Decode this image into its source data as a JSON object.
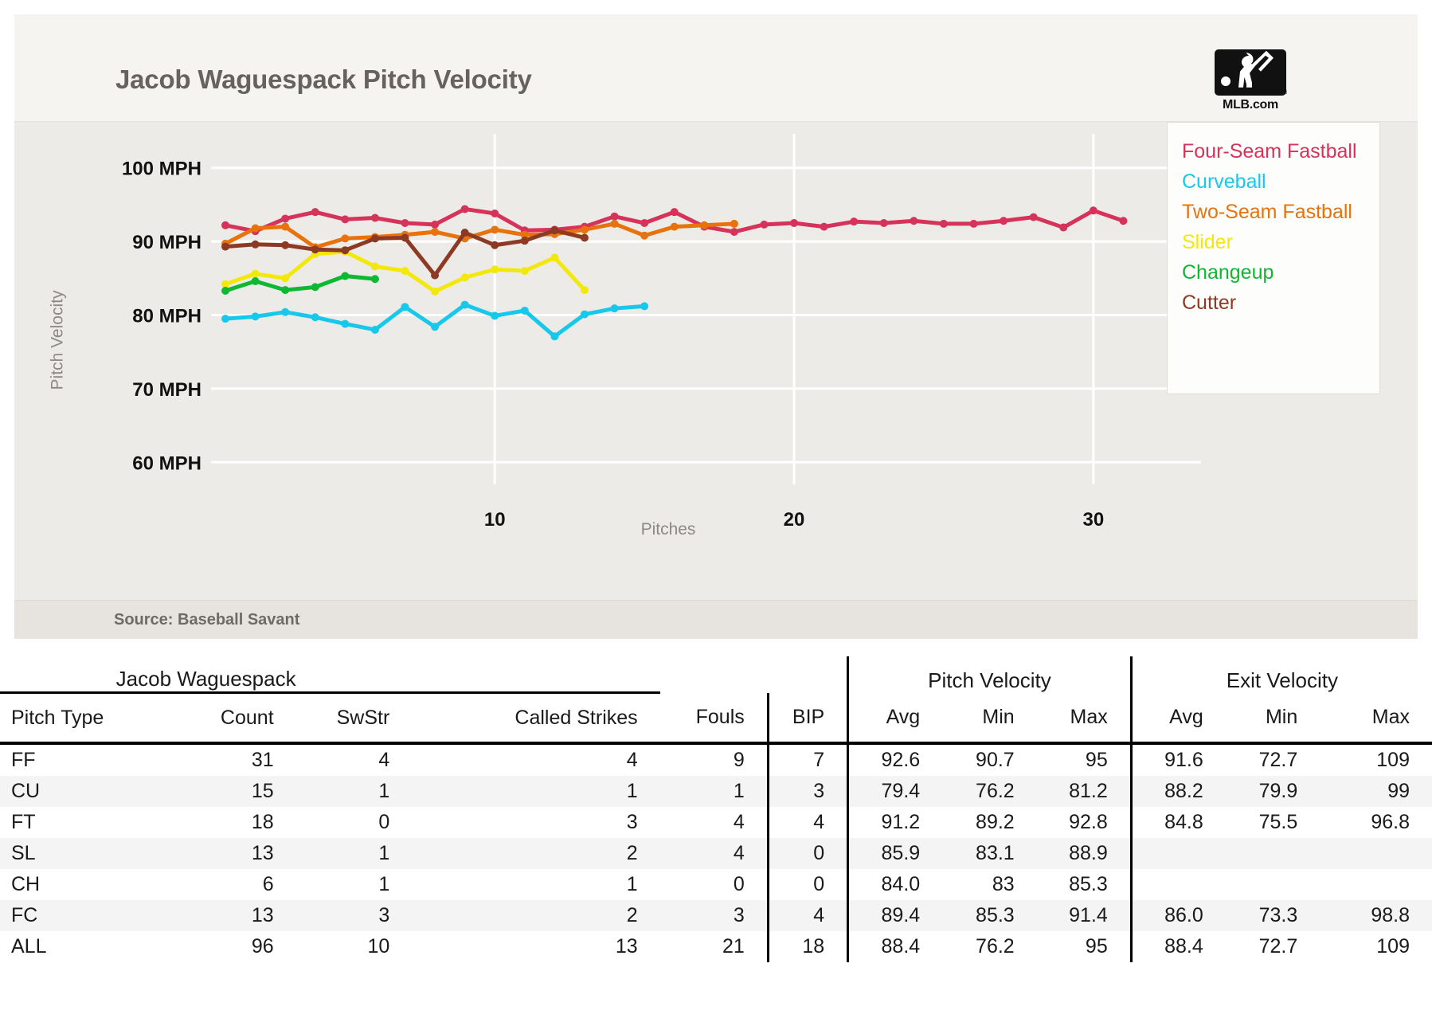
{
  "header": {
    "title": "Jacob Waguespack Pitch Velocity",
    "logo_name": "mlb-logo",
    "logo_text": "MLB.com"
  },
  "source": {
    "text": "Source: Baseball Savant"
  },
  "chart_data": {
    "type": "line",
    "title": "Jacob Waguespack Pitch Velocity",
    "xlabel": "Pitches",
    "ylabel": "Pitch Velocity",
    "xlim": [
      1,
      32
    ],
    "ylim": [
      57,
      103
    ],
    "xticks": [
      10,
      20,
      30
    ],
    "xticklabels": [
      "10",
      "20",
      "30"
    ],
    "yticks": [
      60,
      70,
      80,
      90,
      100
    ],
    "yticklabels": [
      "60 MPH",
      "70 MPH",
      "80 MPH",
      "90 MPH",
      "100 MPH"
    ],
    "grid": true,
    "legend_position": "right",
    "series": [
      {
        "name": "Four-Seam Fastball",
        "color": "#d6335b",
        "x": [
          1,
          2,
          3,
          4,
          5,
          6,
          7,
          8,
          9,
          10,
          11,
          12,
          13,
          14,
          15,
          16,
          17,
          18,
          19,
          20,
          21,
          22,
          23,
          24,
          25,
          26,
          27,
          28,
          29,
          30,
          31
        ],
        "y": [
          92.2,
          91.4,
          93.1,
          94.0,
          93.0,
          93.2,
          92.5,
          92.3,
          94.4,
          93.8,
          91.5,
          91.6,
          92.0,
          93.4,
          92.5,
          94.0,
          92.0,
          91.3,
          92.3,
          92.5,
          92.0,
          92.7,
          92.5,
          92.8,
          92.4,
          92.4,
          92.8,
          93.3,
          91.9,
          94.2,
          92.8
        ]
      },
      {
        "name": "Curveball",
        "color": "#17c8ea",
        "x": [
          1,
          2,
          3,
          4,
          5,
          6,
          7,
          8,
          9,
          10,
          11,
          12,
          13,
          14,
          15
        ],
        "y": [
          79.5,
          79.8,
          80.4,
          79.7,
          78.8,
          78.0,
          81.1,
          78.4,
          81.4,
          79.9,
          80.6,
          77.1,
          80.1,
          80.9,
          81.2
        ]
      },
      {
        "name": "Two-Seam Fastball",
        "color": "#e8720c",
        "x": [
          1,
          2,
          3,
          4,
          5,
          6,
          7,
          8,
          9,
          10,
          11,
          12,
          13,
          14,
          15,
          16,
          17,
          18
        ],
        "y": [
          89.7,
          91.8,
          92.0,
          89.2,
          90.4,
          90.6,
          90.9,
          91.3,
          90.4,
          91.6,
          90.9,
          91.0,
          91.6,
          92.4,
          90.8,
          92.0,
          92.2,
          92.4
        ]
      },
      {
        "name": "Slider",
        "color": "#f2e80e",
        "x": [
          1,
          2,
          3,
          4,
          5,
          6,
          7,
          8,
          9,
          10,
          11,
          12,
          13
        ],
        "y": [
          84.2,
          85.6,
          85.0,
          88.3,
          88.6,
          86.6,
          86.0,
          83.2,
          85.1,
          86.2,
          86.0,
          87.8,
          83.4
        ]
      },
      {
        "name": "Changeup",
        "color": "#0fb832",
        "x": [
          1,
          2,
          3,
          4,
          5,
          6
        ],
        "y": [
          83.3,
          84.6,
          83.4,
          83.8,
          85.3,
          84.9
        ]
      },
      {
        "name": "Cutter",
        "color": "#8d3a24",
        "x": [
          1,
          2,
          3,
          4,
          5,
          6,
          7,
          8,
          9,
          10,
          11,
          12,
          13
        ],
        "y": [
          89.3,
          89.6,
          89.5,
          88.9,
          88.8,
          90.4,
          90.5,
          85.4,
          91.2,
          89.5,
          90.1,
          91.5,
          90.5
        ]
      }
    ]
  },
  "table": {
    "player_group": "Jacob Waguespack",
    "pitch_velocity_group": "Pitch Velocity",
    "exit_velocity_group": "Exit Velocity",
    "columns": [
      "Pitch Type",
      "Count",
      "SwStr",
      "Called Strikes",
      "Fouls",
      "BIP",
      "Avg",
      "Min",
      "Max",
      "Avg",
      "Min",
      "Max"
    ],
    "rows": [
      {
        "pitch_type": "FF",
        "count": "31",
        "swstr": "4",
        "called_strikes": "4",
        "fouls": "9",
        "bip": "7",
        "pv_avg": "92.6",
        "pv_min": "90.7",
        "pv_max": "95",
        "ev_avg": "91.6",
        "ev_min": "72.7",
        "ev_max": "109"
      },
      {
        "pitch_type": "CU",
        "count": "15",
        "swstr": "1",
        "called_strikes": "1",
        "fouls": "1",
        "bip": "3",
        "pv_avg": "79.4",
        "pv_min": "76.2",
        "pv_max": "81.2",
        "ev_avg": "88.2",
        "ev_min": "79.9",
        "ev_max": "99"
      },
      {
        "pitch_type": "FT",
        "count": "18",
        "swstr": "0",
        "called_strikes": "3",
        "fouls": "4",
        "bip": "4",
        "pv_avg": "91.2",
        "pv_min": "89.2",
        "pv_max": "92.8",
        "ev_avg": "84.8",
        "ev_min": "75.5",
        "ev_max": "96.8"
      },
      {
        "pitch_type": "SL",
        "count": "13",
        "swstr": "1",
        "called_strikes": "2",
        "fouls": "4",
        "bip": "0",
        "pv_avg": "85.9",
        "pv_min": "83.1",
        "pv_max": "88.9",
        "ev_avg": "",
        "ev_min": "",
        "ev_max": ""
      },
      {
        "pitch_type": "CH",
        "count": "6",
        "swstr": "1",
        "called_strikes": "1",
        "fouls": "0",
        "bip": "0",
        "pv_avg": "84.0",
        "pv_min": "83",
        "pv_max": "85.3",
        "ev_avg": "",
        "ev_min": "",
        "ev_max": ""
      },
      {
        "pitch_type": "FC",
        "count": "13",
        "swstr": "3",
        "called_strikes": "2",
        "fouls": "3",
        "bip": "4",
        "pv_avg": "89.4",
        "pv_min": "85.3",
        "pv_max": "91.4",
        "ev_avg": "86.0",
        "ev_min": "73.3",
        "ev_max": "98.8"
      },
      {
        "pitch_type": "ALL",
        "count": "96",
        "swstr": "10",
        "called_strikes": "13",
        "fouls": "21",
        "bip": "18",
        "pv_avg": "88.4",
        "pv_min": "76.2",
        "pv_max": "95",
        "ev_avg": "88.4",
        "ev_min": "72.7",
        "ev_max": "109"
      }
    ]
  }
}
